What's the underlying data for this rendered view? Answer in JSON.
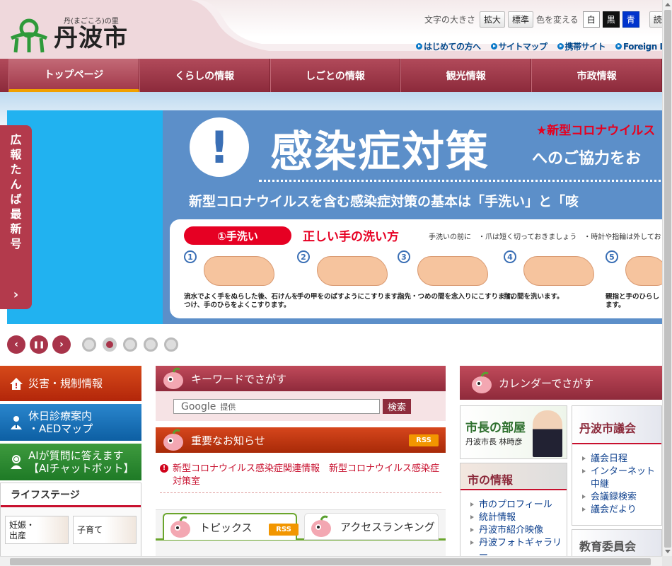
{
  "header": {
    "logo_tagline": "丹(まごころ)の里",
    "logo_name": "丹波市",
    "font_size_label": "文字の大きさ",
    "font_size_enlarge": "拡大",
    "font_size_standard": "標準",
    "color_label": "色を変える",
    "color_white": "白",
    "color_black": "黒",
    "color_blue": "青",
    "read_aloud": "読み上げ",
    "links": [
      "はじめての方へ",
      "サイトマップ",
      "携帯サイト",
      "Foreign Language"
    ]
  },
  "nav": {
    "items": [
      "トップページ",
      "くらしの情報",
      "しごとの情報",
      "観光情報",
      "市政情報"
    ]
  },
  "slider": {
    "title": "感染症対策",
    "red_label": "★新型コロナウイルス",
    "subtitle": "へのご協力をお",
    "exclamation": "!",
    "line2": "新型コロナウイルスを含む感染症対策の基本は「手洗い」と「咳",
    "pill": "①手洗い",
    "panel_title": "正しい手の洗い方",
    "panel_note": "手洗いの前に　・爪は短く切っておきましょう　・時計や指輪は外してお",
    "steps": [
      {
        "num": "1",
        "caption": "流水でよく手をぬらした後、石けんをつけ、手のひらをよくこすります。"
      },
      {
        "num": "2",
        "caption": "手の甲をのばすようにこすります。"
      },
      {
        "num": "3",
        "caption": "指先・つめの間を念入りにこすります。"
      },
      {
        "num": "4",
        "caption": "指の間を洗います。"
      },
      {
        "num": "5",
        "caption": "親指と手のひらします。"
      }
    ],
    "side_tab_chars": [
      "広",
      "報",
      "た",
      "ん",
      "ば",
      "最",
      "新",
      "号"
    ],
    "side_tab_arrow": "›",
    "prev": "‹",
    "pause": "❚❚",
    "next": "›",
    "pages": 5,
    "active_page": 2
  },
  "left": {
    "disaster": "災害・規制情報",
    "clinic_line1": "休日診療案内",
    "clinic_line2": "・AEDマップ",
    "ai_line1": "AIが質問に答えます",
    "ai_line2": "【AIチャットボット】",
    "lifestage_title": "ライフステージ",
    "card1_line1": "妊娠・",
    "card1_line2": "出産",
    "card2": "子育て"
  },
  "middle": {
    "keyword_title": "キーワードでさがす",
    "google_label": "Google",
    "google_sub": "提供",
    "search_button": "検索",
    "news_title": "重要なお知らせ",
    "rss": "RSS",
    "news_link1": "新型コロナウイルス感染症関連情報",
    "news_link2": "新型コロナウイルス感染症対策室",
    "tab_topics": "トピックス",
    "tab_ranking": "アクセスランキング"
  },
  "right": {
    "calendar_title": "カレンダーでさがす",
    "mayor_title": "市長の部屋",
    "mayor_sub": "丹波市長 林時彦",
    "city_title": "市の情報",
    "city_links": [
      "市のプロフィール",
      "統計情報",
      "丹波市紹介映像",
      "丹波フォトギャラリー"
    ],
    "council_title": "丹波市議会",
    "council_links": [
      "議会日程",
      "インターネット中継",
      "会議録検索",
      "議会だより"
    ],
    "edu_title": "教育委員会"
  }
}
